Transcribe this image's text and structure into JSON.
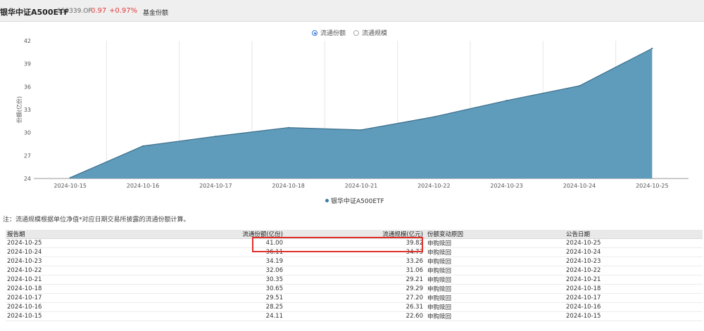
{
  "header": {
    "fund_name": "银华中证A500ETF",
    "fund_code": "159339.OF",
    "price": "0.97",
    "change_pct": "+0.97%",
    "tab_label": "基金份额"
  },
  "toggles": {
    "options": [
      {
        "label": "流通份额",
        "checked": true
      },
      {
        "label": "流通规模",
        "checked": false
      }
    ]
  },
  "legend": {
    "series_name": "银华中证A500ETF",
    "color": "#3a7fa6"
  },
  "chart_data": {
    "type": "area",
    "x": [
      "2024-10-15",
      "2024-10-16",
      "2024-10-17",
      "2024-10-18",
      "2024-10-21",
      "2024-10-22",
      "2024-10-23",
      "2024-10-24",
      "2024-10-25"
    ],
    "series": [
      {
        "name": "银华中证A500ETF",
        "values": [
          24.11,
          28.25,
          29.51,
          30.65,
          30.35,
          32.06,
          34.19,
          36.11,
          41.0
        ]
      }
    ],
    "ylabel": "份额(亿份)",
    "ylim": [
      24,
      42
    ],
    "yticks": [
      24,
      27,
      30,
      33,
      36,
      39,
      42
    ],
    "grid": "vertical",
    "colors": {
      "fill": "#5f9bba",
      "line": "#3d6f8c"
    }
  },
  "note": "注：流通规模根据单位净值*对应日期交易所披露的流通份额计算。",
  "table": {
    "headers": [
      "报告期",
      "流通份额(亿份)",
      "流通规模(亿元)",
      "份额变动原因",
      "公告日期"
    ],
    "rows": [
      [
        "2024-10-25",
        "41.00",
        "39.82",
        "申购赎回",
        "2024-10-25"
      ],
      [
        "2024-10-24",
        "36.11",
        "34.73",
        "申购赎回",
        "2024-10-24"
      ],
      [
        "2024-10-23",
        "34.19",
        "33.26",
        "申购赎回",
        "2024-10-23"
      ],
      [
        "2024-10-22",
        "32.06",
        "31.06",
        "申购赎回",
        "2024-10-22"
      ],
      [
        "2024-10-21",
        "30.35",
        "29.21",
        "申购赎回",
        "2024-10-21"
      ],
      [
        "2024-10-18",
        "30.65",
        "29.29",
        "申购赎回",
        "2024-10-18"
      ],
      [
        "2024-10-17",
        "29.51",
        "27.20",
        "申购赎回",
        "2024-10-17"
      ],
      [
        "2024-10-16",
        "28.25",
        "26.31",
        "申购赎回",
        "2024-10-16"
      ],
      [
        "2024-10-15",
        "24.11",
        "22.60",
        "申购赎回",
        "2024-10-15"
      ]
    ]
  }
}
